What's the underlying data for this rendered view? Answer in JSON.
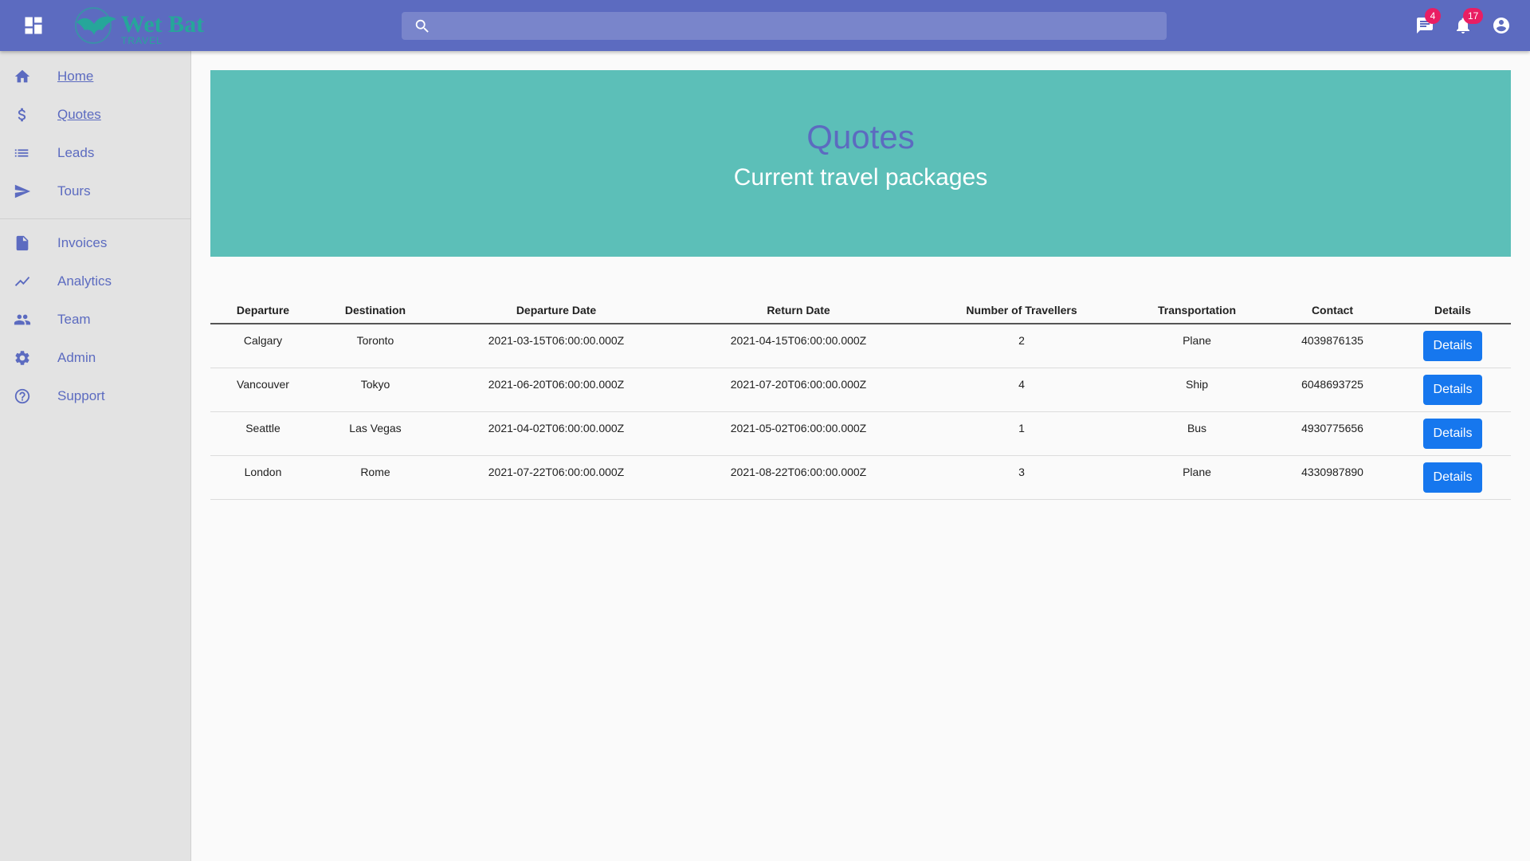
{
  "app": {
    "brand": "Wet Bat",
    "brand_sub": "TRAVEL"
  },
  "topbar": {
    "search_placeholder": "",
    "messages_count": "4",
    "notifications_count": "17"
  },
  "sidebar": {
    "items": [
      {
        "label": "Home",
        "icon": "home-icon",
        "active": true
      },
      {
        "label": "Quotes",
        "icon": "dollar-icon",
        "active": true
      },
      {
        "label": "Leads",
        "icon": "list-icon",
        "active": false
      },
      {
        "label": "Tours",
        "icon": "send-icon",
        "active": false
      },
      {
        "label": "Invoices",
        "icon": "document-icon",
        "active": false
      },
      {
        "label": "Analytics",
        "icon": "trending-icon",
        "active": false
      },
      {
        "label": "Team",
        "icon": "people-icon",
        "active": false
      },
      {
        "label": "Admin",
        "icon": "gear-icon",
        "active": false
      },
      {
        "label": "Support",
        "icon": "help-icon",
        "active": false
      }
    ]
  },
  "hero": {
    "title": "Quotes",
    "subtitle": "Current travel packages"
  },
  "table": {
    "headers": [
      "Departure",
      "Destination",
      "Departure Date",
      "Return Date",
      "Number of Travellers",
      "Transportation",
      "Contact",
      "Details"
    ],
    "rows": [
      {
        "departure": "Calgary",
        "destination": "Toronto",
        "departure_date": "2021-03-15T06:00:00.000Z",
        "return_date": "2021-04-15T06:00:00.000Z",
        "travellers": "2",
        "transportation": "Plane",
        "contact": "4039876135",
        "details_label": "Details"
      },
      {
        "departure": "Vancouver",
        "destination": "Tokyo",
        "departure_date": "2021-06-20T06:00:00.000Z",
        "return_date": "2021-07-20T06:00:00.000Z",
        "travellers": "4",
        "transportation": "Ship",
        "contact": "6048693725",
        "details_label": "Details"
      },
      {
        "departure": "Seattle",
        "destination": "Las Vegas",
        "departure_date": "2021-04-02T06:00:00.000Z",
        "return_date": "2021-05-02T06:00:00.000Z",
        "travellers": "1",
        "transportation": "Bus",
        "contact": "4930775656",
        "details_label": "Details"
      },
      {
        "departure": "London",
        "destination": "Rome",
        "departure_date": "2021-07-22T06:00:00.000Z",
        "return_date": "2021-08-22T06:00:00.000Z",
        "travellers": "3",
        "transportation": "Plane",
        "contact": "4330987890",
        "details_label": "Details"
      }
    ]
  },
  "colors": {
    "appbar": "#5c6bc0",
    "hero": "#5cbfb8",
    "badge": "#e91e63",
    "button": "#1677ee",
    "brand": "#26a69a"
  }
}
